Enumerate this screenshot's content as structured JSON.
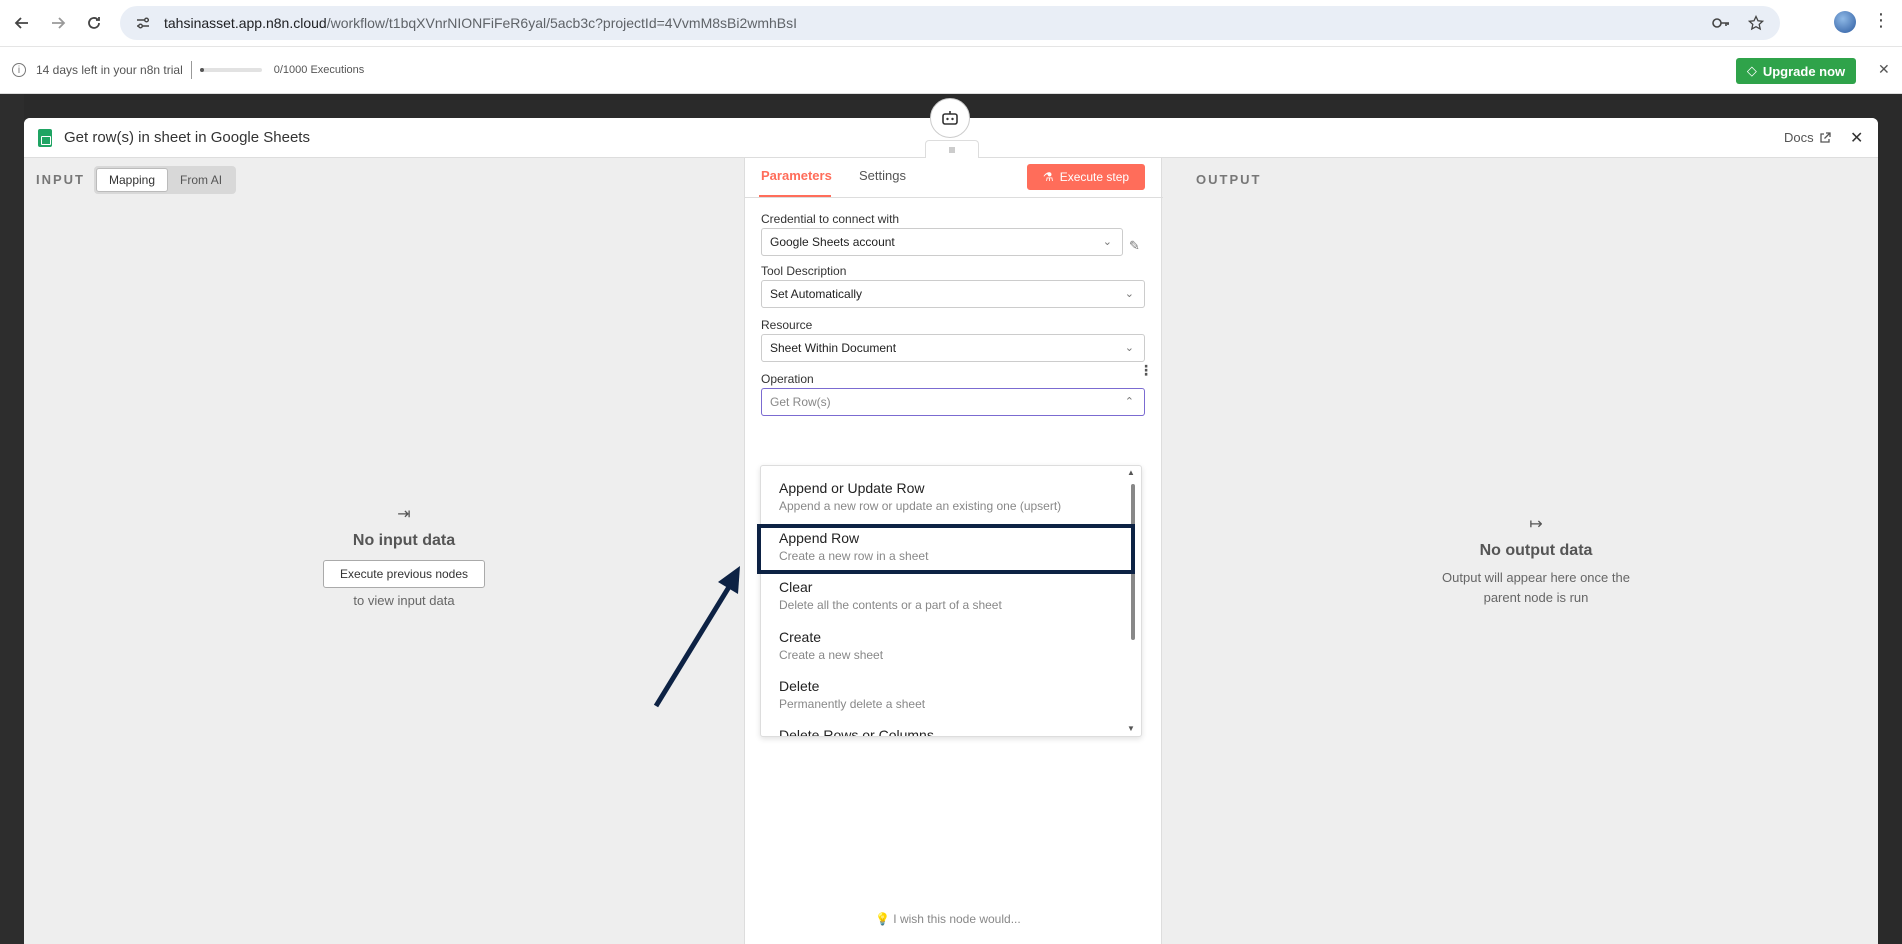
{
  "browser": {
    "url_host": "tahsinasset.app.n8n.cloud",
    "url_path": "/workflow/t1bqXVnrNIONFiFeR6yal/5acb3c?projectId=4VvmM8sBi2wmhBsI"
  },
  "trial": {
    "text": "14 days left in your n8n trial",
    "executions": "0/1000 Executions",
    "executions_progress": 0.0,
    "upgrade_label": "Upgrade now"
  },
  "modal": {
    "title": "Get row(s) in sheet in Google Sheets",
    "docs_label": "Docs"
  },
  "input": {
    "label": "INPUT",
    "toggle_mapping": "Mapping",
    "toggle_from_ai": "From AI",
    "empty_title": "No input data",
    "exec_prev_label": "Execute previous nodes",
    "empty_sub": "to view input data"
  },
  "params": {
    "tab_parameters": "Parameters",
    "tab_settings": "Settings",
    "execute_step": "Execute step",
    "credential_label": "Credential to connect with",
    "credential_value": "Google Sheets account",
    "tool_desc_label": "Tool Description",
    "tool_desc_value": "Set Automatically",
    "resource_label": "Resource",
    "resource_value": "Sheet Within Document",
    "operation_label": "Operation",
    "operation_value": "Get Row(s)",
    "wish_link": "I wish this node would..."
  },
  "dropdown": {
    "items": [
      {
        "title": "Append or Update Row",
        "desc": "Append a new row or update an existing one (upsert)"
      },
      {
        "title": "Append Row",
        "desc": "Create a new row in a sheet"
      },
      {
        "title": "Clear",
        "desc": "Delete all the contents or a part of a sheet"
      },
      {
        "title": "Create",
        "desc": "Create a new sheet"
      },
      {
        "title": "Delete",
        "desc": "Permanently delete a sheet"
      },
      {
        "title": "Delete Rows or Columns",
        "desc": ""
      }
    ]
  },
  "output": {
    "label": "OUTPUT",
    "empty_title": "No output data",
    "empty_sub_1": "Output will appear here once the",
    "empty_sub_2": "parent node is run"
  },
  "colors": {
    "accent": "#ff6d5a",
    "upgrade": "#2fa34a",
    "highlight": "#0d2244"
  }
}
